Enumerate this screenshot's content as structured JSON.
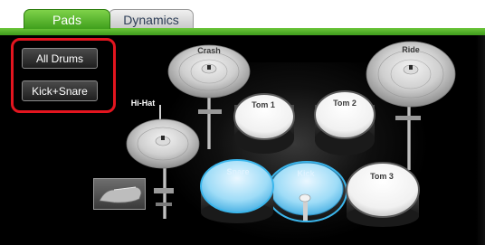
{
  "tabs": [
    {
      "label": "Pads",
      "active": true
    },
    {
      "label": "Dynamics",
      "active": false
    }
  ],
  "presets": {
    "all_drums": "All Drums",
    "kick_snare": "Kick+Snare"
  },
  "kit": {
    "crash": "Crash",
    "ride": "Ride",
    "hihat": "Hi-Hat",
    "tom1": "Tom 1",
    "tom2": "Tom 2",
    "tom3": "Tom 3",
    "snare": "Snare",
    "kick": "Kick"
  },
  "colors": {
    "accent_green": "#4fb426",
    "selection_highlight": "#e3151f",
    "selected_pad_ring": "#3bb6ec"
  }
}
